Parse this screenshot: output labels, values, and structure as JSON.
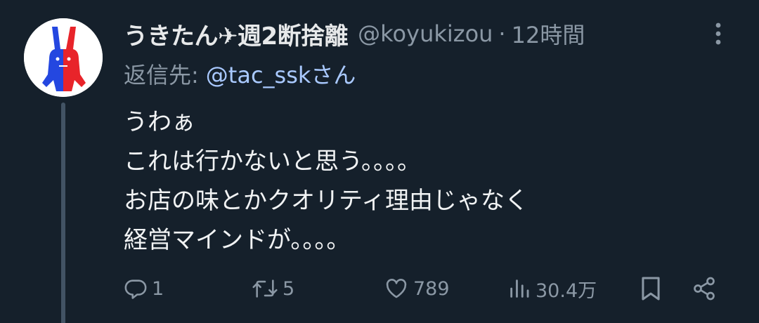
{
  "tweet": {
    "display_name": "うきたん✈週2断捨離",
    "handle": "@koyukizou",
    "separator": "·",
    "time": "12時間",
    "reply_prefix": "返信先:",
    "reply_handle": "@tac_sskさん",
    "body_lines": [
      "うわぁ",
      "これは行かないと思う。。。。",
      "お店の味とかクオリティ理由じゃなく",
      "経営マインドが。。。。"
    ]
  },
  "actions": {
    "replies": "1",
    "retweets": "5",
    "likes": "789",
    "views": "30.4万"
  },
  "icons": {
    "avatar": "rabbit-avatar-icon",
    "more": "more-vertical-icon",
    "reply": "reply-icon",
    "retweet": "retweet-icon",
    "like": "heart-icon",
    "views": "views-bar-chart-icon",
    "bookmark": "bookmark-icon",
    "share": "share-icon"
  },
  "colors": {
    "background": "#15202b",
    "text": "#e7e9ea",
    "muted": "#8b98a5",
    "link": "#a9c9ff",
    "thread_line": "#425364"
  }
}
